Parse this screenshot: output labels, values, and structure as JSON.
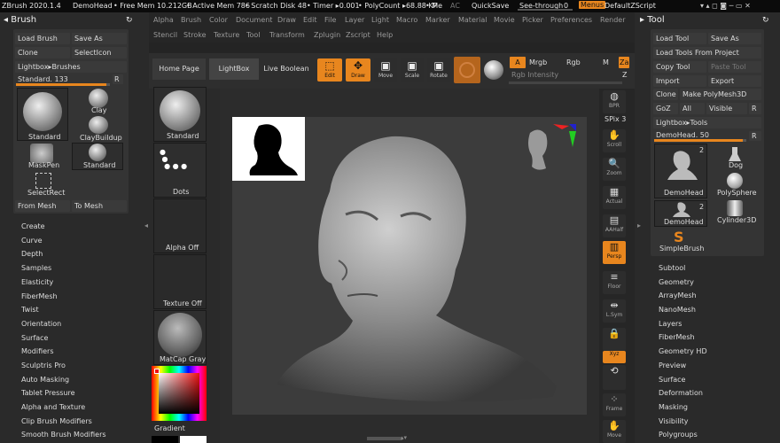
{
  "titlebar": {
    "app": "ZBrush 2020.1.4",
    "doc": "DemoHead",
    "freemem": "• Free Mem 10.212GB",
    "activemem": "• Active Mem 786",
    "scratch": "• Scratch Disk 48",
    "timer": "• Timer ▸0.001",
    "polycount": "• PolyCount ▸68.88 KP",
    "me": "• Me",
    "ac": "AC",
    "quicksave": "QuickSave",
    "seethrough": "See-through",
    "seethrough_val": "0",
    "menus": "Menus",
    "script": "DefaultZScript"
  },
  "menubar1": [
    "Alpha",
    "Brush",
    "Color",
    "Document",
    "Draw",
    "Edit",
    "File",
    "Layer",
    "Light",
    "Macro",
    "Marker",
    "Material",
    "Movie",
    "Picker",
    "Preferences",
    "Render"
  ],
  "menubar2": [
    "Stencil",
    "Stroke",
    "Texture",
    "Tool",
    "Transform",
    "Zplugin",
    "Zscript",
    "Help"
  ],
  "brush": {
    "title": "Brush",
    "load": "Load Brush",
    "saveas": "Save As",
    "clone": "Clone",
    "selecticon": "SelectIcon",
    "lightbox": "Lightbox▸Brushes",
    "standard_label": "Standard. 133",
    "r": "R",
    "items": [
      "Standard",
      "Clay",
      "ClayBuildup",
      "MaskPen",
      "Standard",
      "SelectRect"
    ],
    "frommesh": "From Mesh",
    "tomesh": "To Mesh"
  },
  "leftmenu": [
    "Create",
    "Curve",
    "Depth",
    "Samples",
    "Elasticity",
    "FiberMesh",
    "Twist",
    "Orientation",
    "Surface",
    "Modifiers",
    "Sculptris Pro",
    "Auto Masking",
    "Tablet Pressure",
    "Alpha and Texture",
    "Clip Brush Modifiers",
    "Smooth Brush Modifiers"
  ],
  "tabs": [
    "Home Page",
    "LightBox",
    "Live Boolean"
  ],
  "toolbar": {
    "edit": "Edit",
    "draw": "Draw",
    "move": "Move",
    "scale": "Scale",
    "rotate": "Rotate",
    "a": "A",
    "mrgb": "Mrgb",
    "rgb": "Rgb",
    "m": "M",
    "zadd": "Za",
    "rgb_intensity": "Rgb Intensity",
    "z": "Z"
  },
  "shelf": {
    "standard": "Standard",
    "dots": "Dots",
    "alphaoff": "Alpha Off",
    "textureoff": "Texture Off",
    "matcap": "MatCap Gray",
    "gradient": "Gradient"
  },
  "rightdock": [
    "BPR",
    "SPix 3",
    "Scroll",
    "Zoom",
    "Actual",
    "AAHalf",
    "Persp",
    "Floor",
    "L.Sym",
    "Xyz",
    "Frame",
    "Move"
  ],
  "tool": {
    "title": "Tool",
    "loadtool": "Load Tool",
    "saveas": "Save As",
    "loadproject": "Load Tools From Project",
    "copytool": "Copy Tool",
    "pastetool": "Paste Tool",
    "import": "Import",
    "export": "Export",
    "clone": "Clone",
    "makepoly": "Make PolyMesh3D",
    "goz": "GoZ",
    "all": "All",
    "visible": "Visible",
    "r": "R",
    "lightbox": "Lightbox▸Tools",
    "demohead": "DemoHead. 50",
    "items": [
      "DemoHead",
      "Dog",
      "PolySphere",
      "DemoHead",
      "Cylinder3D",
      "SimpleBrush"
    ],
    "badge": "2"
  },
  "rightmenu": [
    "Subtool",
    "Geometry",
    "ArrayMesh",
    "NanoMesh",
    "Layers",
    "FiberMesh",
    "Geometry HD",
    "Preview",
    "Surface",
    "Deformation",
    "Masking",
    "Visibility",
    "Polygroups"
  ]
}
